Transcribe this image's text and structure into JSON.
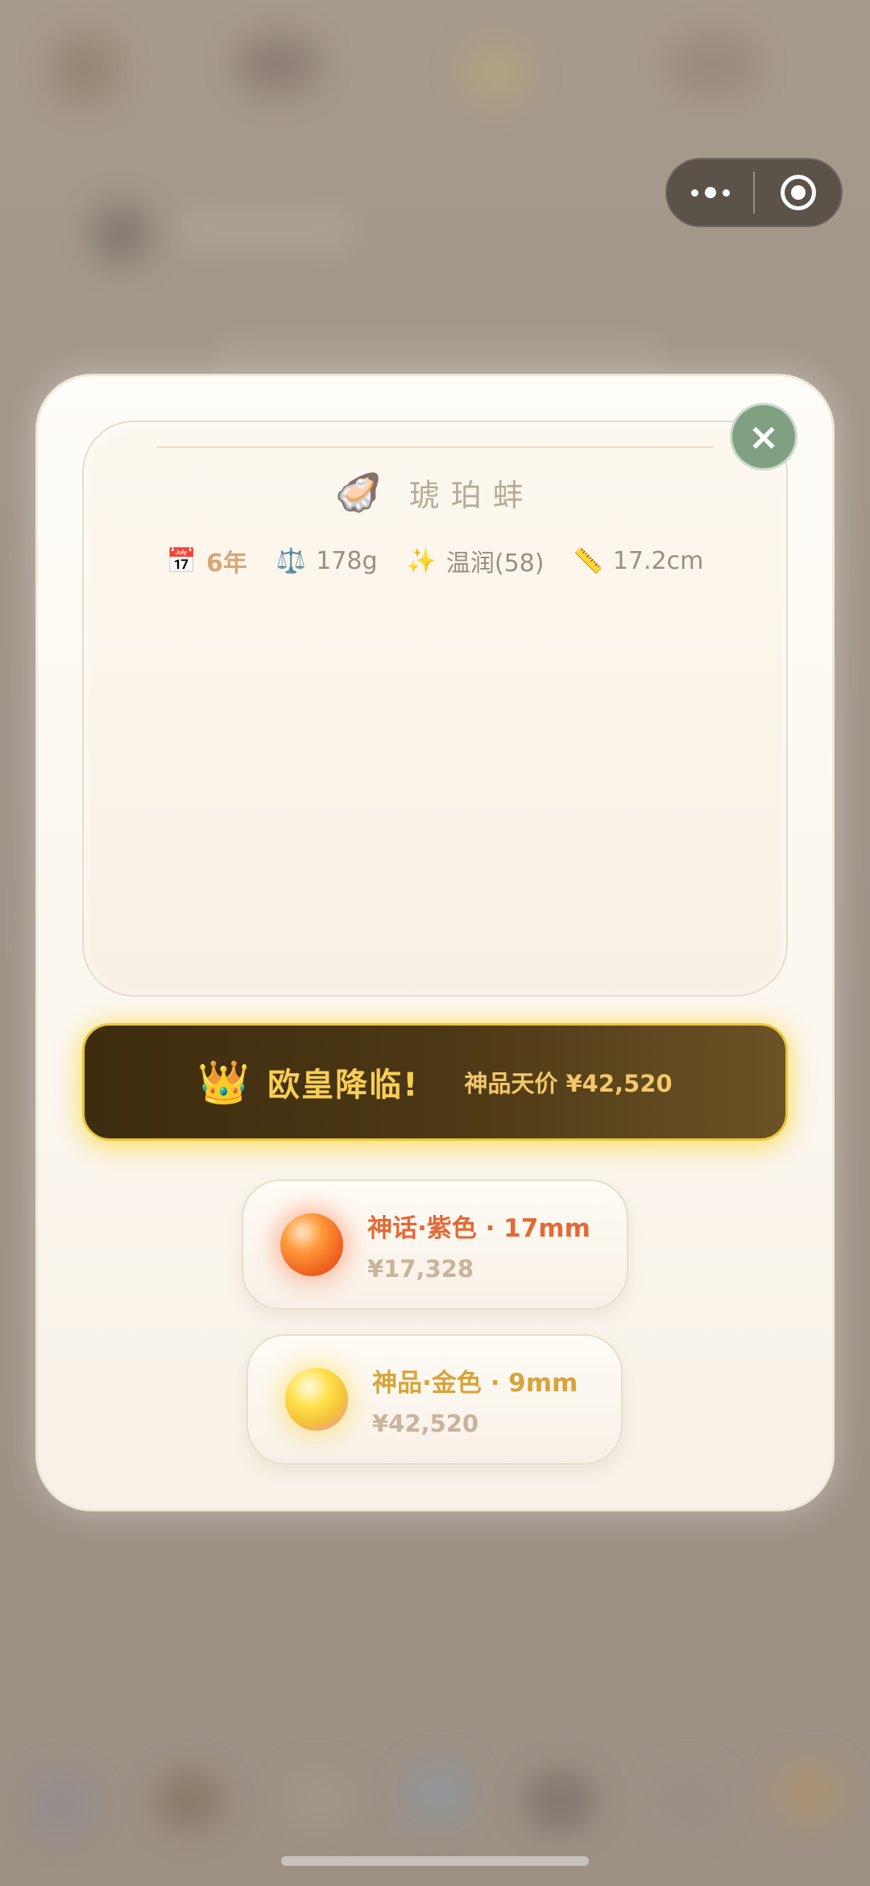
{
  "capsule": {
    "more_icon": "more-dots-icon",
    "target_icon": "target-circle-icon"
  },
  "modal": {
    "close_label": "×",
    "shell": {
      "icon": "🦪",
      "name": "琥珀蚌",
      "stats": {
        "age_icon": "📅",
        "age": "6年",
        "weight_icon": "⚖️",
        "weight": "178g",
        "quality_icon": "✨",
        "quality": "温润(58)",
        "length_icon": "📏",
        "length": "17.2cm"
      }
    },
    "banner": {
      "crown_icon": "👑",
      "headline": "欧皇降临!",
      "sub": "神品天价 ¥42,520"
    },
    "pearls": [
      {
        "title": "神话·紫色 · 17mm",
        "price": "¥17,328",
        "color": "#e36a37"
      },
      {
        "title": "神品·金色 · 9mm",
        "price": "¥42,520",
        "color": "#d7a43c"
      }
    ]
  }
}
